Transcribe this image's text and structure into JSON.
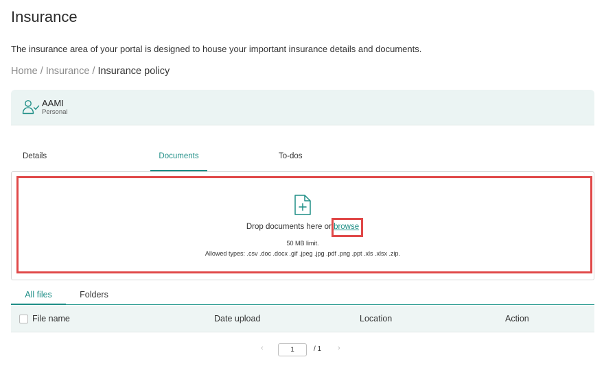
{
  "page": {
    "title": "Insurance",
    "description": "The insurance area of your portal is designed to house your important insurance details and documents."
  },
  "breadcrumb": {
    "items": [
      "Home",
      "Insurance",
      "Insurance policy"
    ],
    "separator": "/"
  },
  "policy": {
    "name": "AAMI",
    "type": "Personal",
    "icon": "user-check-icon"
  },
  "tabs": [
    {
      "label": "Details",
      "active": false
    },
    {
      "label": "Documents",
      "active": true
    },
    {
      "label": "To-dos",
      "active": false
    }
  ],
  "upload": {
    "icon": "file-plus-icon",
    "drop_text": "Drop documents here or",
    "browse_label": "browse",
    "limit_text": "50 MB limit.",
    "allowed_types": "Allowed types: .csv .doc .docx .gif .jpeg .jpg .pdf .png .ppt .xls .xlsx .zip."
  },
  "file_tabs": [
    {
      "label": "All files",
      "active": true
    },
    {
      "label": "Folders",
      "active": false
    }
  ],
  "table": {
    "columns": [
      "File name",
      "Date upload",
      "Location",
      "Action"
    ]
  },
  "pagination": {
    "current_page": "1",
    "total_text": "/ 1"
  },
  "colors": {
    "accent": "#1e8e86",
    "highlight": "#e04848",
    "card_bg": "#ebf4f3"
  }
}
